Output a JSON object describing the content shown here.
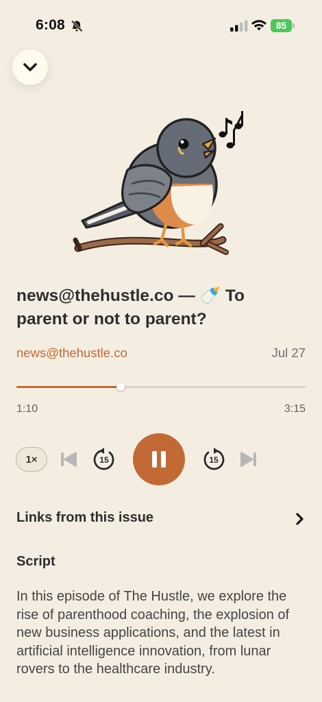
{
  "status_bar": {
    "time": "6:08",
    "battery": "85"
  },
  "episode": {
    "title": "news@thehustle.co — 🍼 To parent or not to parent?",
    "source": "news@thehustle.co",
    "date": "Jul 27"
  },
  "player": {
    "elapsed": "1:10",
    "total": "3:15",
    "progress_fraction": 0.36,
    "speed": "1×",
    "rewind_seconds": "15",
    "forward_seconds": "15",
    "state": "playing"
  },
  "links": {
    "label": "Links from this issue"
  },
  "script": {
    "heading": "Script",
    "body": "In this episode of The Hustle, we explore the rise of parenthood coaching, the explosion of new business applications, and the latest in artificial intelligence innovation, from lunar rovers to the healthcare industry."
  },
  "colors": {
    "background": "#F4EEE2",
    "accent": "#C26A35",
    "battery": "#4CC75A"
  },
  "icons": {
    "collapse": "chevron-down-icon",
    "links": "chevron-right-icon",
    "notification": "bell-slash-icon"
  }
}
